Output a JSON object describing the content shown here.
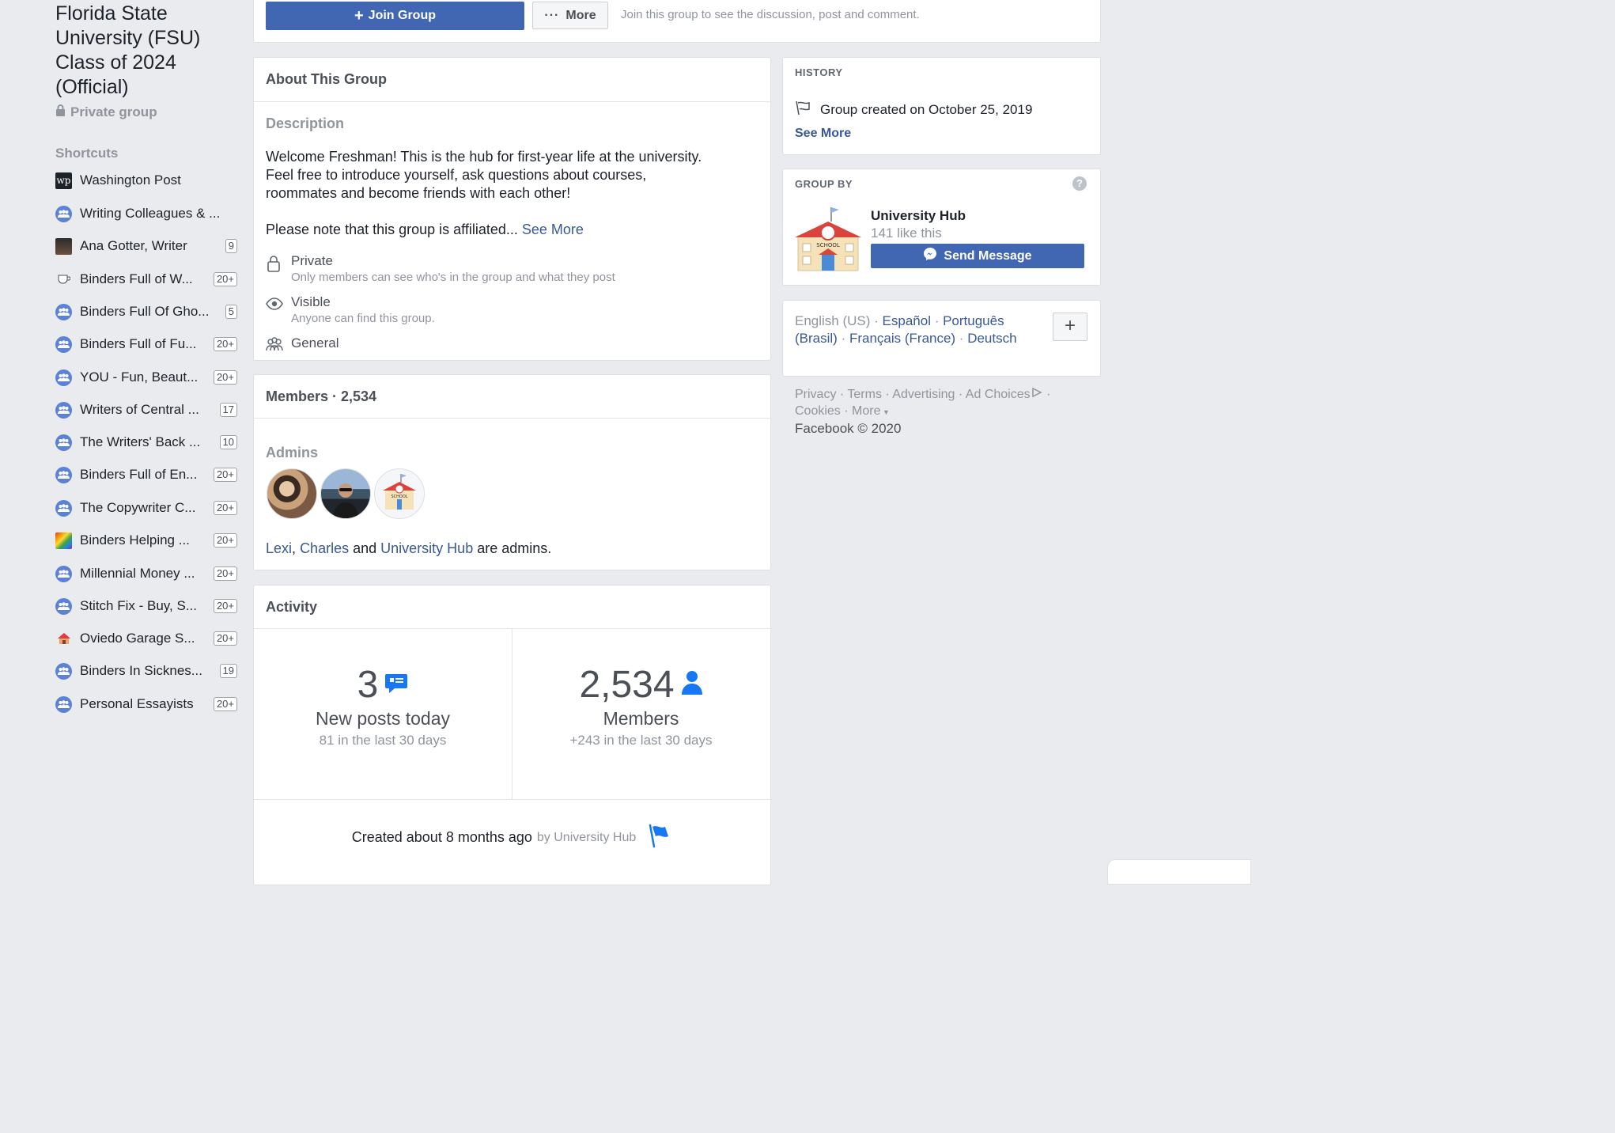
{
  "group": {
    "title": "Florida State University (FSU) Class of 2024 (Official)",
    "privacy": "Private group"
  },
  "shortcuts": {
    "heading": "Shortcuts",
    "items": [
      {
        "label": "Washington Post",
        "badge": "",
        "icon": "washington-post-icon"
      },
      {
        "label": "Writing Colleagues & ...",
        "badge": "",
        "icon": "group-icon"
      },
      {
        "label": "Ana Gotter, Writer",
        "badge": "9",
        "icon": "page-photo-icon"
      },
      {
        "label": "Binders Full of W...",
        "badge": "20+",
        "icon": "coffee-icon"
      },
      {
        "label": "Binders Full Of Gho...",
        "badge": "5",
        "icon": "group-icon"
      },
      {
        "label": "Binders Full of Fu...",
        "badge": "20+",
        "icon": "group-icon"
      },
      {
        "label": "YOU - Fun, Beaut...",
        "badge": "20+",
        "icon": "group-icon"
      },
      {
        "label": "Writers of Central ...",
        "badge": "17",
        "icon": "group-icon"
      },
      {
        "label": "The Writers' Back ...",
        "badge": "10",
        "icon": "group-icon"
      },
      {
        "label": "Binders Full of En...",
        "badge": "20+",
        "icon": "group-icon"
      },
      {
        "label": "The Copywriter C...",
        "badge": "20+",
        "icon": "group-icon"
      },
      {
        "label": "Binders Helping ...",
        "badge": "20+",
        "icon": "rainbow-icon"
      },
      {
        "label": "Millennial Money ...",
        "badge": "20+",
        "icon": "group-icon"
      },
      {
        "label": "Stitch Fix - Buy, S...",
        "badge": "20+",
        "icon": "group-icon"
      },
      {
        "label": "Oviedo Garage S...",
        "badge": "20+",
        "icon": "house-icon"
      },
      {
        "label": "Binders In Sicknes...",
        "badge": "19",
        "icon": "group-icon"
      },
      {
        "label": "Personal Essayists",
        "badge": "20+",
        "icon": "group-icon"
      }
    ]
  },
  "topbar": {
    "join_label": "Join Group",
    "more_label": "More",
    "hint": "Join this group to see the discussion, post and comment."
  },
  "about": {
    "heading": "About This Group",
    "description_heading": "Description",
    "description_line1": "Welcome Freshman! This is the hub for first-year life at the university.",
    "description_line2": "Feel free to introduce yourself, ask questions about courses,",
    "description_line3": "roommates and become friends with each other!",
    "affiliation_text": "Please note that this group is affiliated...",
    "see_more": "See More",
    "settings": [
      {
        "title": "Private",
        "sub": "Only members can see who's in the group and what they post"
      },
      {
        "title": "Visible",
        "sub": "Anyone can find this group."
      },
      {
        "title": "General",
        "sub": ""
      }
    ]
  },
  "members": {
    "heading": "Members · 2,534",
    "admins_heading": "Admins",
    "admin_names": [
      "Lexi",
      "Charles",
      "University Hub"
    ],
    "sep_comma": ",",
    "sep_and": "and",
    "suffix": "are admins."
  },
  "activity": {
    "heading": "Activity",
    "posts_count": "3",
    "posts_label": "New posts today",
    "posts_sub": "81 in the last 30 days",
    "members_count": "2,534",
    "members_label": "Members",
    "members_sub": "+243 in the last 30 days",
    "created_text": "Created about 8 months ago",
    "created_by": "by University Hub"
  },
  "history": {
    "heading": "HISTORY",
    "created": "Group created on October 25, 2019",
    "see_more": "See More"
  },
  "group_by": {
    "heading": "GROUP BY",
    "name": "University Hub",
    "likes": "141 like this",
    "send_label": "Send Message",
    "school_text": "SCHOOL"
  },
  "languages": {
    "current": "English (US)",
    "options": [
      "Español",
      "Português (Brasil)",
      "Français (France)",
      "Deutsch"
    ],
    "add_label": "+"
  },
  "footer": {
    "links": [
      "Privacy",
      "Terms",
      "Advertising",
      "Ad Choices",
      "Cookies",
      "More"
    ],
    "copyright": "Facebook © 2020"
  },
  "colors": {
    "brand": "#4267b2",
    "link": "#385898",
    "icon_blue": "#1877f2"
  }
}
